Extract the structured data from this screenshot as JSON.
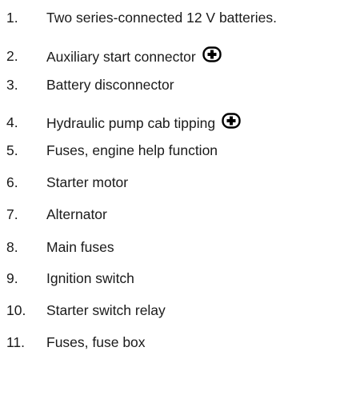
{
  "items": [
    {
      "number": "1.",
      "text": "Two series-connected 12 V batteries.",
      "icon": null
    },
    {
      "number": "2.",
      "text": "Auxiliary start connector",
      "icon": "plus-icon"
    },
    {
      "number": "3.",
      "text": "Battery disconnector",
      "icon": null
    },
    {
      "number": "4.",
      "text": "Hydraulic pump cab tipping",
      "icon": "plus-icon"
    },
    {
      "number": "5.",
      "text": "Fuses, engine help function",
      "icon": null
    },
    {
      "number": "6.",
      "text": "Starter motor",
      "icon": null
    },
    {
      "number": "7.",
      "text": "Alternator",
      "icon": null
    },
    {
      "number": "8.",
      "text": "Main fuses",
      "icon": null
    },
    {
      "number": "9.",
      "text": "Ignition switch",
      "icon": null
    },
    {
      "number": "10.",
      "text": "Starter switch relay",
      "icon": null
    },
    {
      "number": "11.",
      "text": "Fuses, fuse box",
      "icon": null
    }
  ]
}
